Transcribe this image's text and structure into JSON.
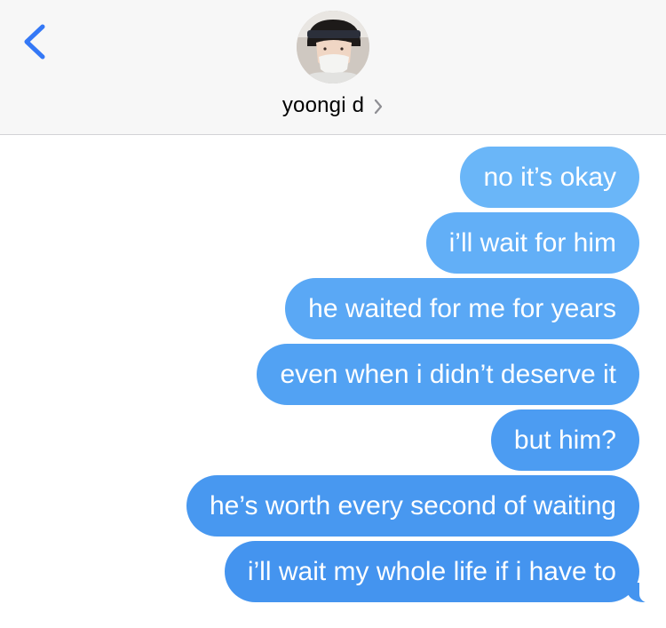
{
  "header": {
    "back_icon": "chevron-left-icon",
    "contact_name": "yoongi d",
    "contact_chevron_icon": "chevron-right-icon",
    "avatar_icon": "contact-photo"
  },
  "messages": [
    {
      "text": "no it’s okay",
      "color": "#6ab6f8"
    },
    {
      "text": "i’ll wait for him",
      "color": "#62aff7"
    },
    {
      "text": "he waited for me for years",
      "color": "#5aa8f5"
    },
    {
      "text": "even when i didn’t deserve it",
      "color": "#52a2f3"
    },
    {
      "text": "but him?",
      "color": "#4c9cf2"
    },
    {
      "text": "he’s worth every second of waiting",
      "color": "#4898f0"
    },
    {
      "text": "i’ll wait my whole life if i have to",
      "color": "#4494ef"
    }
  ],
  "colors": {
    "header_bg": "#f7f7f7",
    "accent": "#3478f6",
    "bubble_text": "#ffffff"
  }
}
